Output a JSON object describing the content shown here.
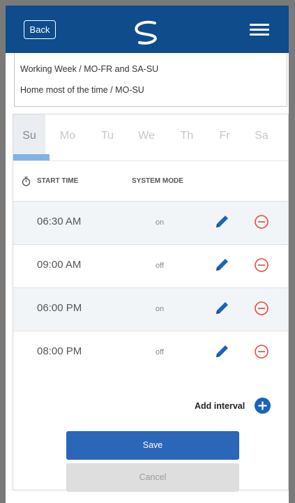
{
  "header": {
    "back_label": "Back"
  },
  "dropdown": {
    "options": [
      "Working Week / MO-FR and SA-SU",
      "Home most of the time / MO-SU"
    ]
  },
  "days": [
    "Su",
    "Mo",
    "Tu",
    "We",
    "Th",
    "Fr",
    "Sa"
  ],
  "selected_day": "Su",
  "columns": {
    "start_time": "START TIME",
    "system_mode": "SYSTEM MODE"
  },
  "intervals": [
    {
      "time": "06:30 AM",
      "mode": "on"
    },
    {
      "time": "09:00 AM",
      "mode": "off"
    },
    {
      "time": "06:00 PM",
      "mode": "on"
    },
    {
      "time": "08:00 PM",
      "mode": "off"
    }
  ],
  "add_interval_label": "Add interval",
  "save_label": "Save",
  "cancel_label": "Cancel",
  "colors": {
    "header_bg": "#0e4c8c",
    "accent_blue": "#2a67b8",
    "delete_red": "#e64a3b",
    "active_day_bar": "#7fb3e6"
  }
}
